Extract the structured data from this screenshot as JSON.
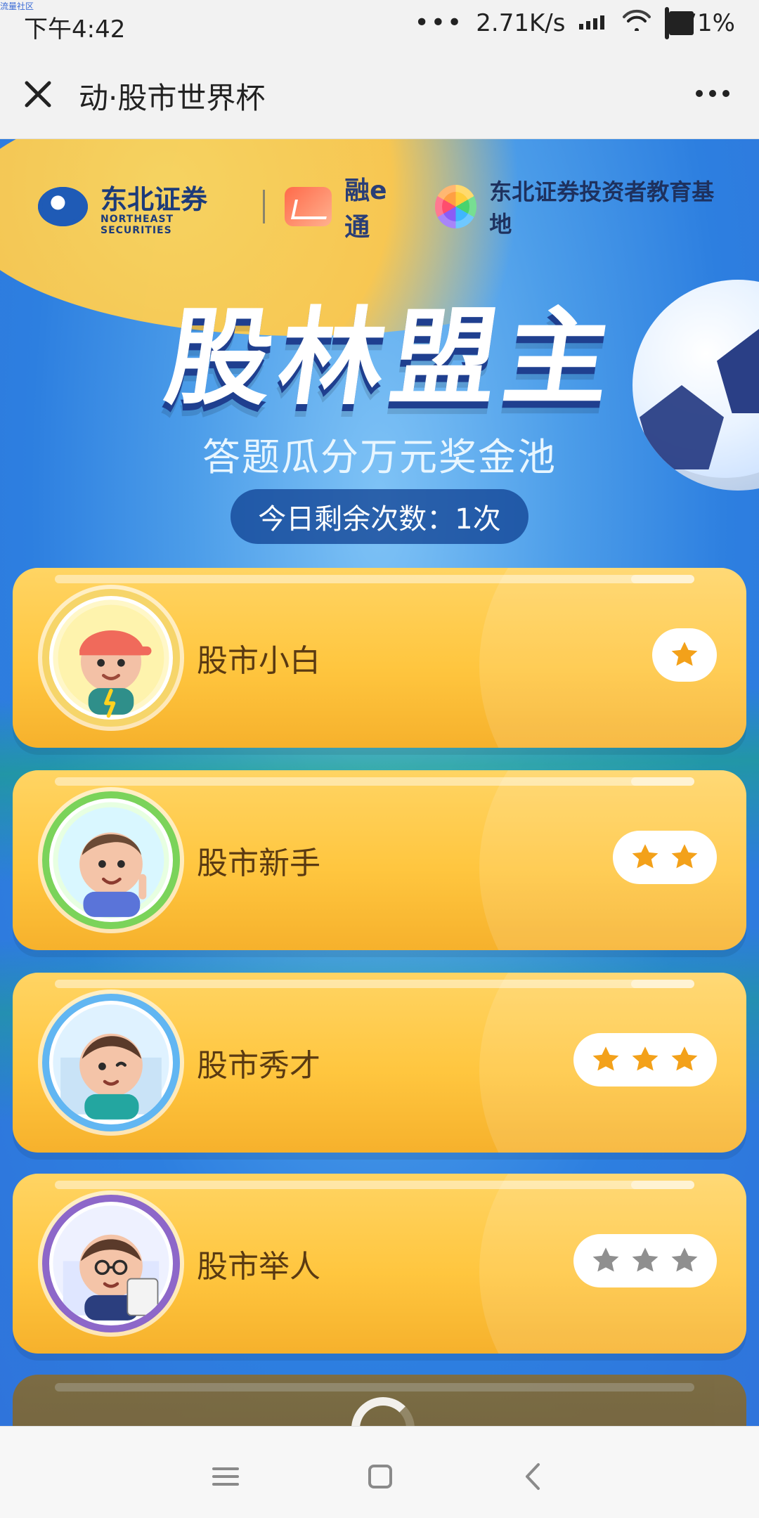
{
  "status_bar": {
    "time": "下午4:42",
    "network_speed": "2.71K/s",
    "battery_percent": "71%",
    "battery_level": 0.71,
    "tiny_watermark": "流量社区"
  },
  "nav": {
    "title": "动·股市世界杯"
  },
  "header": {
    "brand_cn": "东北证券",
    "brand_en": "NORTHEAST SECURITIES",
    "partner_name": "融e通",
    "edu_base": "东北证券投资者教育基地",
    "hero_title": "股林盟主",
    "hero_subtitle": "答题瓜分万元奖金池",
    "remaining_text": "今日剩余次数：1次"
  },
  "levels": [
    {
      "label": "股市小白",
      "stars_filled": 1,
      "stars_total": 1,
      "star_color": "#f3a11a",
      "ring_color": "#f6d56a"
    },
    {
      "label": "股市新手",
      "stars_filled": 2,
      "stars_total": 2,
      "star_color": "#f3a11a",
      "ring_color": "#7bd35a"
    },
    {
      "label": "股市秀才",
      "stars_filled": 3,
      "stars_total": 3,
      "star_color": "#f3a11a",
      "ring_color": "#61b6f2"
    },
    {
      "label": "股市举人",
      "stars_filled": 0,
      "stars_total": 3,
      "star_color": "#8f8f8f",
      "ring_color": "#8d67c9"
    }
  ],
  "icons": {
    "close": "close-icon",
    "more": "more-icon",
    "signal": "signal-icon",
    "wifi": "wifi-icon",
    "battery": "battery-icon",
    "menu": "menu-icon",
    "home": "home-icon",
    "back": "back-icon"
  }
}
